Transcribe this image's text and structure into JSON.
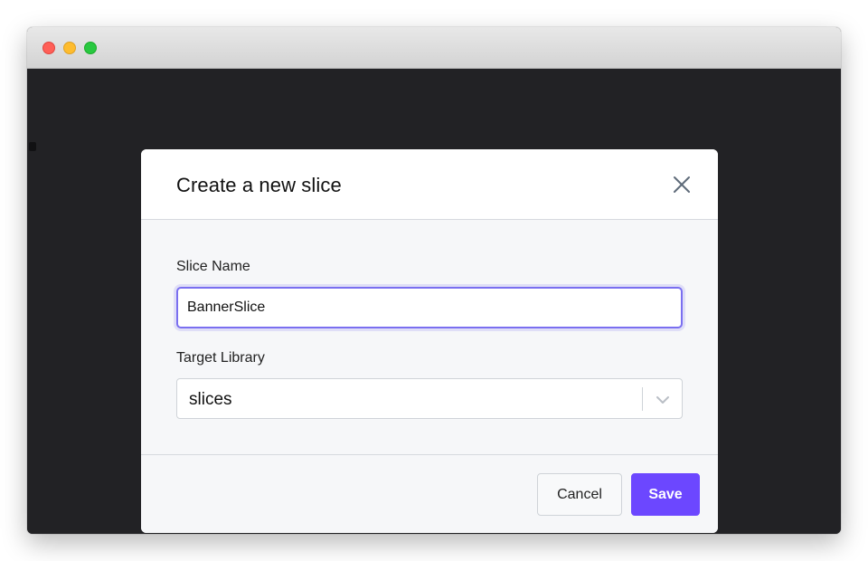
{
  "window": {
    "buttons": [
      "close",
      "minimize",
      "maximize"
    ]
  },
  "modal": {
    "title": "Create a new slice",
    "close_icon": "close-icon",
    "fields": {
      "slice_name": {
        "label": "Slice Name",
        "value": "BannerSlice"
      },
      "target_library": {
        "label": "Target Library",
        "value": "slices",
        "icon": "chevron-down-icon"
      }
    },
    "footer": {
      "cancel_label": "Cancel",
      "save_label": "Save"
    }
  },
  "colors": {
    "accent": "#6c47ff",
    "focus_ring": "#7a6ff0",
    "backdrop": "#222225",
    "modal_body": "#f6f7f9"
  }
}
